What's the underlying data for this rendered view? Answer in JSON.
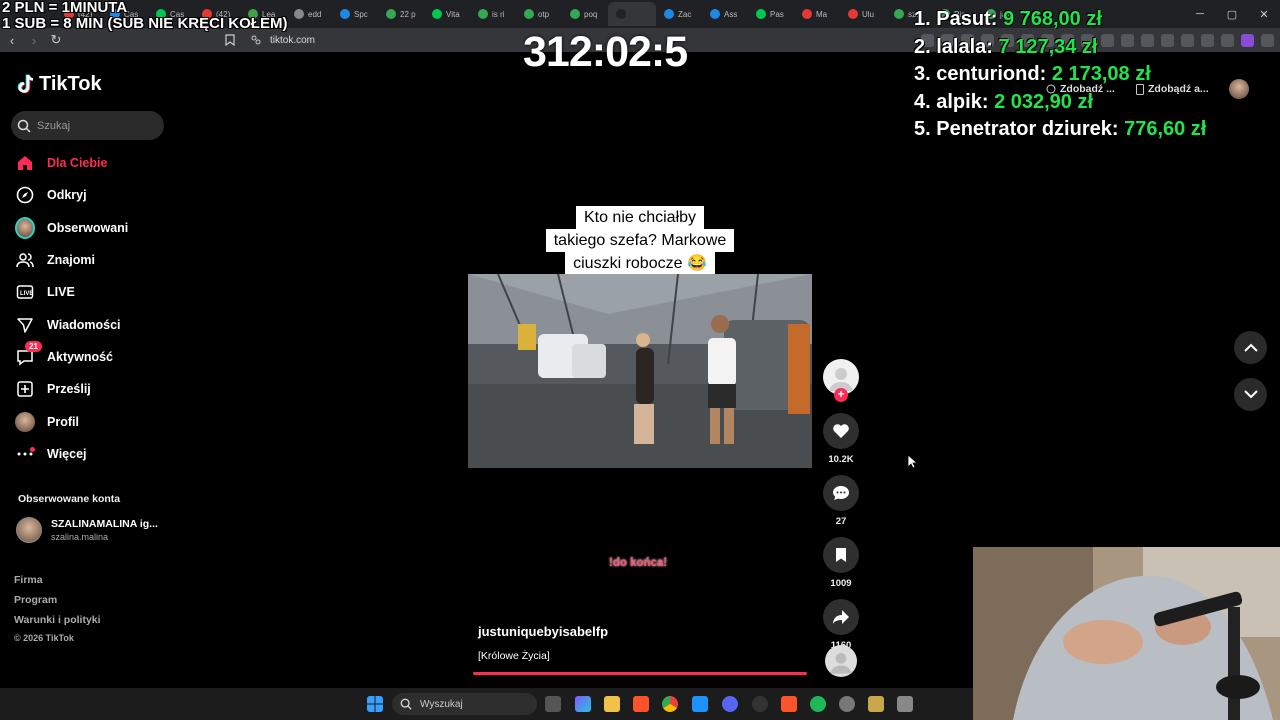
{
  "stream_overlay": {
    "line1": "2 PLN = 1MINUTA",
    "line2": "1 SUB = 8 MIN (SUB NIE KRĘCI KOŁEM)",
    "timer": "312:02:5",
    "leaderboard": [
      {
        "rank": "1.",
        "name": "Pasut:",
        "amount": "9 768,00 zł"
      },
      {
        "rank": "2.",
        "name": "lalala:",
        "amount": "7 127,34 zł"
      },
      {
        "rank": "3.",
        "name": "centuriond:",
        "amount": "2 173,08 zł"
      },
      {
        "rank": "4.",
        "name": "alpik:",
        "amount": "2 032,90 zł"
      },
      {
        "rank": "5.",
        "name": "Penetrator dziurek:",
        "amount": "776,60 zł"
      }
    ],
    "accent_color": "#22e34b"
  },
  "browser": {
    "url": "tiktok.com",
    "tabs": [
      "(42)",
      "Cas",
      "Cas",
      "(42)",
      "Lea",
      "edd",
      "Spc",
      "22 p",
      "Vita",
      "is ri",
      "otp",
      "poq",
      "",
      "Zac",
      "Ass",
      "Pas",
      "Ma",
      "Ulu",
      "szc",
      "Pic",
      "jak"
    ],
    "active_tab_index": 12
  },
  "tiktok": {
    "brand": "TikTok",
    "brand_color": "#fe2c55",
    "search_placeholder": "Szukaj",
    "nav": [
      {
        "label": "Dla Ciebie",
        "icon": "home-icon"
      },
      {
        "label": "Odkryj",
        "icon": "compass-icon"
      },
      {
        "label": "Obserwowani",
        "icon": "avatar-icon"
      },
      {
        "label": "Znajomi",
        "icon": "friends-icon"
      },
      {
        "label": "LIVE",
        "icon": "live-icon"
      },
      {
        "label": "Wiadomości",
        "icon": "send-icon"
      },
      {
        "label": "Aktywność",
        "icon": "inbox-icon",
        "badge": "21"
      },
      {
        "label": "Prześlij",
        "icon": "upload-icon"
      },
      {
        "label": "Profil",
        "icon": "profile-avatar-icon"
      },
      {
        "label": "Więcej",
        "icon": "more-icon"
      }
    ],
    "followed_heading": "Obserwowane konta",
    "followed": {
      "name": "SZALINAMALINA ig...",
      "handle": "szalina.malina"
    },
    "footer": [
      "Firma",
      "Program",
      "Warunki i polityki"
    ],
    "copyright": "© 2026 TikTok",
    "get_app_1": "Zdobądź ...",
    "get_app_2": "Zdobądź a..."
  },
  "video": {
    "caption_lines": [
      "Kto nie chciałby",
      "takiego szefa? Markowe",
      "ciuszki robocze 😂"
    ],
    "subtitle": "!do końca!",
    "author": "justuniquebyisabelfp",
    "description": "[Królowe Życia]",
    "likes": "10.2K",
    "comments": "27",
    "saves": "1009",
    "shares": "1160"
  },
  "taskbar": {
    "search_placeholder": "Wyszukaj"
  }
}
